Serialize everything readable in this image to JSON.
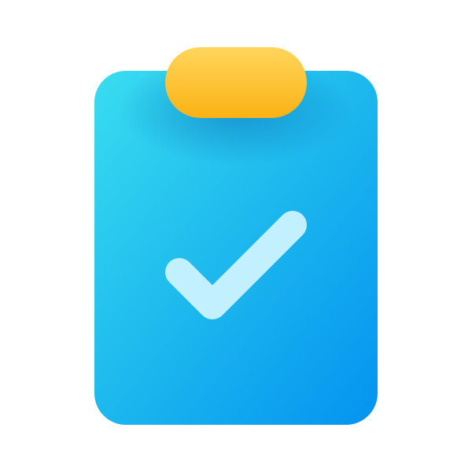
{
  "icon": {
    "name": "clipboard-check-icon",
    "colors": {
      "board_top_left": "#39DDF0",
      "board_mid": "#1CB8EE",
      "board_bottom_right": "#0493F0",
      "clip_top": "#FFD65C",
      "clip_bottom": "#FBB214",
      "checkmark": "#C3F0FF",
      "shadow": "#0A6FB8"
    }
  }
}
